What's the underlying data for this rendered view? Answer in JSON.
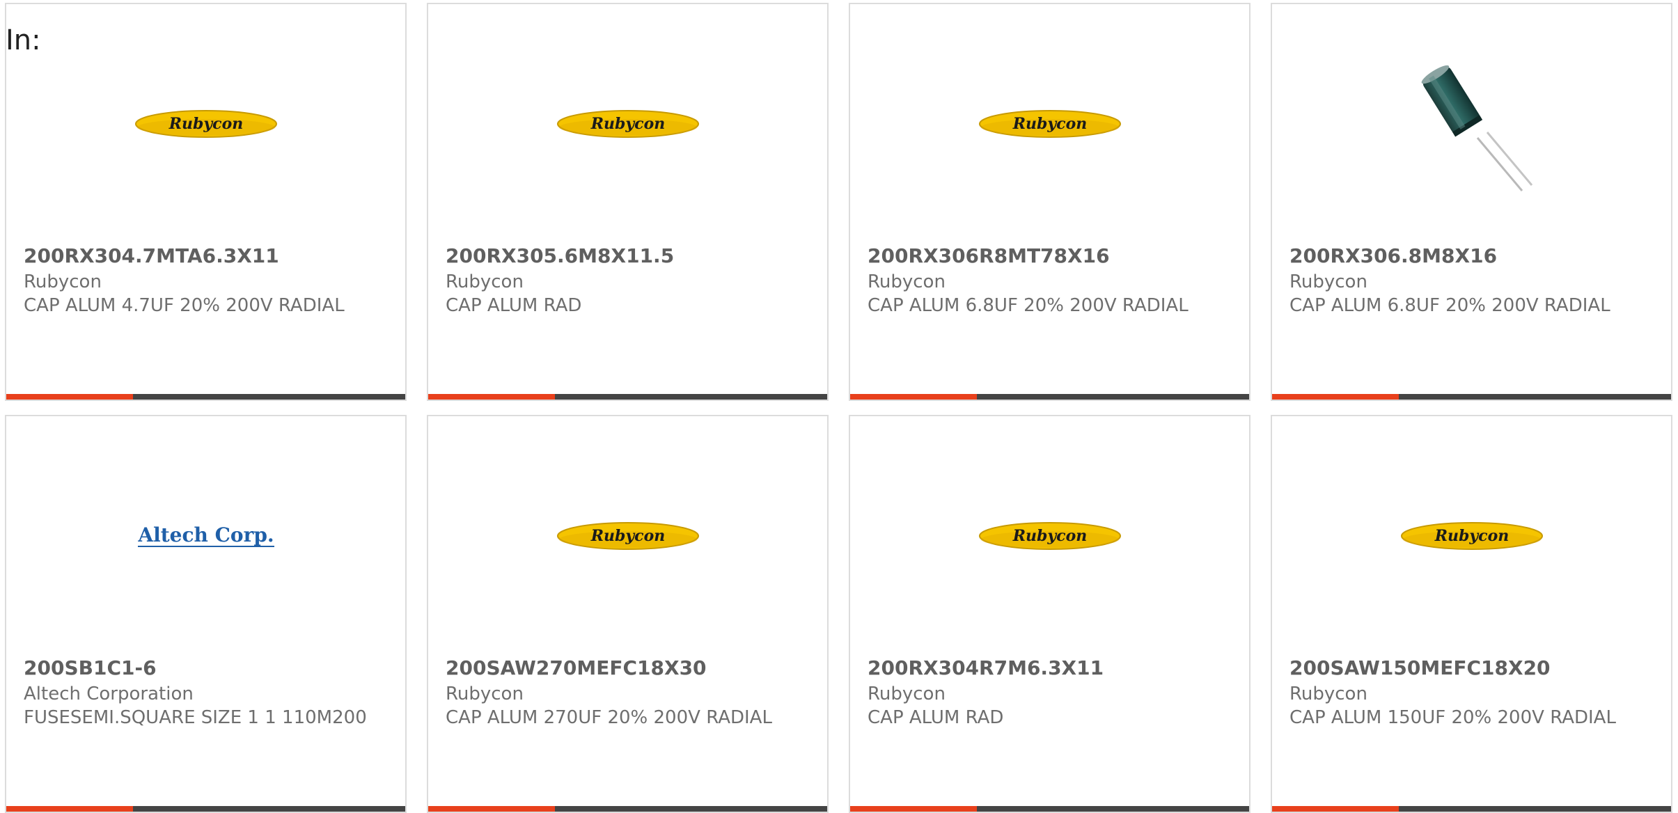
{
  "heading": "In:",
  "colors": {
    "accent": "#e8401c",
    "bar": "#444444",
    "rubycon_yellow": "#f5c400",
    "altech_blue": "#1f5fa8"
  },
  "cards": [
    {
      "part": "200RX304.7MTA6.3X11",
      "manufacturer": "Rubycon",
      "description": "CAP ALUM 4.7UF 20% 200V RADIAL",
      "image": "rubycon-logo",
      "logo_text": "Rubycon"
    },
    {
      "part": "200RX305.6M8X11.5",
      "manufacturer": "Rubycon",
      "description": "CAP ALUM RAD",
      "image": "rubycon-logo",
      "logo_text": "Rubycon"
    },
    {
      "part": "200RX306R8MT78X16",
      "manufacturer": "Rubycon",
      "description": "CAP ALUM 6.8UF 20% 200V RADIAL",
      "image": "rubycon-logo",
      "logo_text": "Rubycon"
    },
    {
      "part": "200RX306.8M8X16",
      "manufacturer": "Rubycon",
      "description": "CAP ALUM 6.8UF 20% 200V RADIAL",
      "image": "capacitor-photo"
    },
    {
      "part": "200SB1C1-6",
      "manufacturer": "Altech Corporation",
      "description": "FUSESEMI.SQUARE SIZE 1 1 110M200",
      "image": "altech-logo",
      "logo_text": "Altech Corp."
    },
    {
      "part": "200SAW270MEFC18X30",
      "manufacturer": "Rubycon",
      "description": "CAP ALUM 270UF 20% 200V RADIAL",
      "image": "rubycon-logo",
      "logo_text": "Rubycon"
    },
    {
      "part": "200RX304R7M6.3X11",
      "manufacturer": "Rubycon",
      "description": "CAP ALUM RAD",
      "image": "rubycon-logo",
      "logo_text": "Rubycon"
    },
    {
      "part": "200SAW150MEFC18X20",
      "manufacturer": "Rubycon",
      "description": "CAP ALUM 150UF 20% 200V RADIAL",
      "image": "rubycon-logo",
      "logo_text": "Rubycon"
    }
  ]
}
